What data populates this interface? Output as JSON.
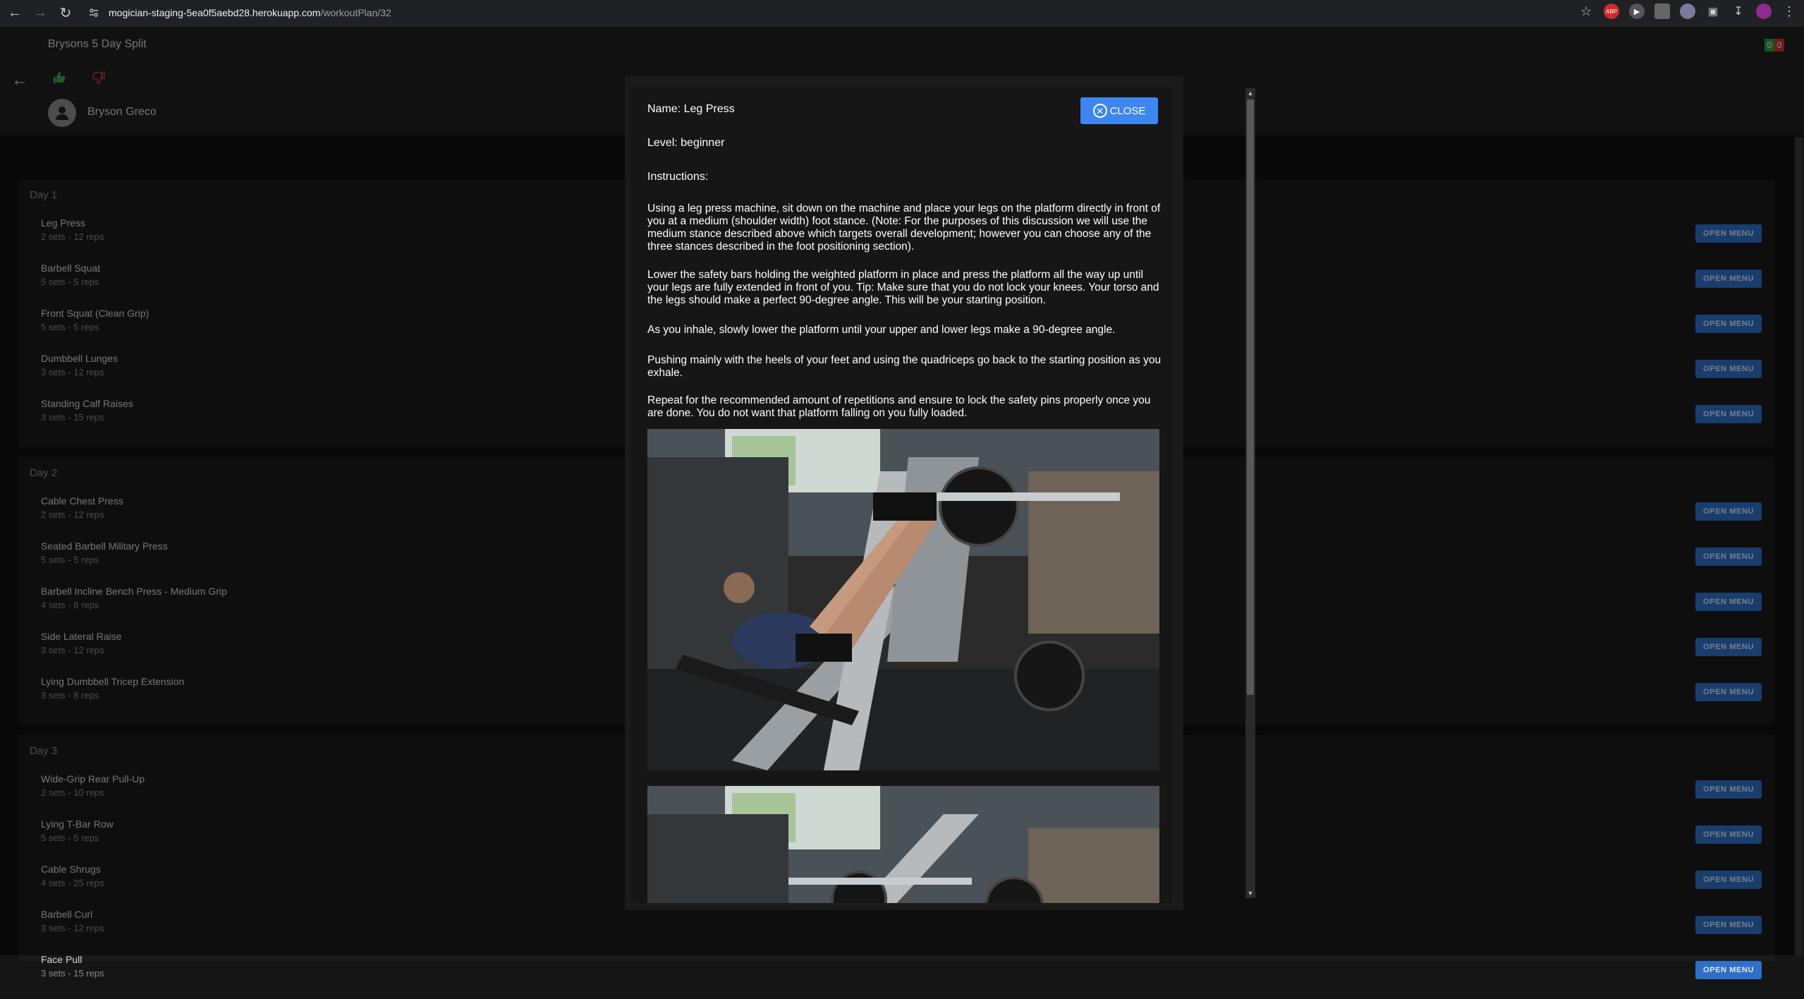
{
  "browser": {
    "url_host": "mogician-staging-5ea0f5aebd28.herokuapp.com",
    "url_path": "/workoutPlan/32"
  },
  "header": {
    "plan_title": "Brysons 5 Day Split",
    "badge_green": "0",
    "badge_red": "0",
    "user_name": "Bryson Greco"
  },
  "open_menu_label": "OPEN MENU",
  "days": [
    {
      "label": "Day 1",
      "exercises": [
        {
          "name": "Leg Press",
          "sets": "2 sets - 12 reps"
        },
        {
          "name": "Barbell Squat",
          "sets": "5 sets - 5 reps"
        },
        {
          "name": "Front Squat (Clean Grip)",
          "sets": "5 sets - 5 reps"
        },
        {
          "name": "Dumbbell Lunges",
          "sets": "3 sets - 12 reps"
        },
        {
          "name": "Standing Calf Raises",
          "sets": "3 sets - 15 reps"
        }
      ]
    },
    {
      "label": "Day 2",
      "exercises": [
        {
          "name": "Cable Chest Press",
          "sets": "2 sets - 12 reps"
        },
        {
          "name": "Seated Barbell Military Press",
          "sets": "5 sets - 5 reps"
        },
        {
          "name": "Barbell Incline Bench Press - Medium Grip",
          "sets": "4 sets - 6 reps"
        },
        {
          "name": "Side Lateral Raise",
          "sets": "3 sets - 12 reps"
        },
        {
          "name": "Lying Dumbbell Tricep Extension",
          "sets": "3 sets - 8 reps"
        }
      ]
    },
    {
      "label": "Day 3",
      "exercises": [
        {
          "name": "Wide-Grip Rear Pull-Up",
          "sets": "2 sets - 10 reps"
        },
        {
          "name": "Lying T-Bar Row",
          "sets": "5 sets - 5 reps"
        },
        {
          "name": "Cable Shrugs",
          "sets": "4 sets - 25 reps"
        },
        {
          "name": "Barbell Curl",
          "sets": "3 sets - 12 reps"
        },
        {
          "name": "Face Pull",
          "sets": "3 sets - 15 reps"
        }
      ]
    }
  ],
  "modal": {
    "name_line": "Name: Leg Press",
    "level_line": "Level: beginner",
    "instructions_heading": "Instructions:",
    "close_label": "CLOSE",
    "paragraphs": [
      "Using a leg press machine, sit down on the machine and place your legs on the platform directly in front of you at a medium (shoulder width) foot stance. (Note: For the purposes of this discussion we will use the medium stance described above which targets overall development; however you can choose any of the three stances described in the foot positioning section).",
      "Lower the safety bars holding the weighted platform in place and press the platform all the way up until your legs are fully extended in front of you. Tip: Make sure that you do not lock your knees. Your torso and the legs should make a perfect 90-degree angle. This will be your starting position.",
      "As you inhale, slowly lower the platform until your upper and lower legs make a 90-degree angle.",
      "Pushing mainly with the heels of your feet and using the quadriceps go back to the starting position as you exhale.",
      "Repeat for the recommended amount of repetitions and ensure to lock the safety pins properly once you are done. You do not want that platform falling on you fully loaded."
    ]
  },
  "colors": {
    "accent_blue": "#3d86f0",
    "open_menu_blue": "#2f6fc6",
    "thumb_up_green": "#3aa757",
    "thumb_down_red": "#c0392b"
  }
}
